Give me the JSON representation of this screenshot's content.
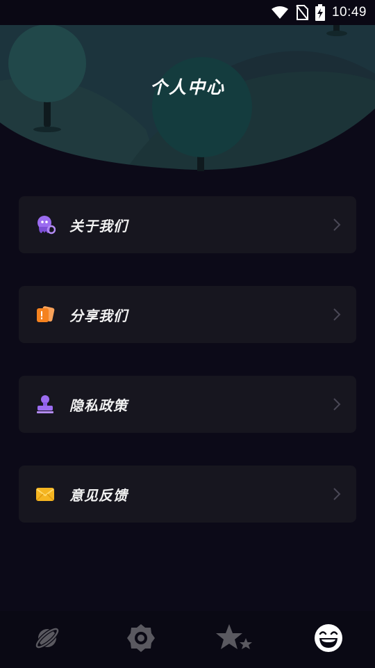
{
  "status_bar": {
    "time": "10:49",
    "icons": [
      "wifi-icon",
      "no-sim-icon",
      "battery-charging-icon"
    ]
  },
  "header": {
    "title": "个人中心"
  },
  "menu": {
    "items": [
      {
        "label": "关于我们",
        "icon": "about-octopus-icon",
        "icon_color": "#9b6cf0"
      },
      {
        "label": "分享我们",
        "icon": "share-card-icon",
        "icon_color": "#f5821f"
      },
      {
        "label": "隐私政策",
        "icon": "privacy-stamp-icon",
        "icon_color": "#9b6cf0"
      },
      {
        "label": "意见反馈",
        "icon": "feedback-envelope-icon",
        "icon_color": "#f5b521"
      }
    ]
  },
  "bottom_nav": {
    "items": [
      {
        "icon": "planet-icon",
        "active": false
      },
      {
        "icon": "gear-icon",
        "active": false
      },
      {
        "icon": "stars-icon",
        "active": false
      },
      {
        "icon": "laughing-face-icon",
        "active": true
      }
    ]
  },
  "colors": {
    "background": "#0c0a18",
    "card": "#17161f",
    "header_hill": "#1e3a3c",
    "tree": "#1d4446",
    "accent_purple": "#9b6cf0",
    "accent_orange": "#f5821f",
    "accent_yellow": "#f5b521"
  }
}
